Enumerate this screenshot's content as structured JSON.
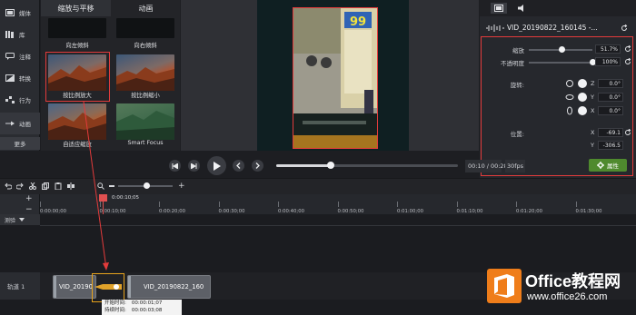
{
  "sidebar": {
    "items": [
      {
        "label": "媒体",
        "icon": "media-icon"
      },
      {
        "label": "库",
        "icon": "library-icon"
      },
      {
        "label": "注释",
        "icon": "annotation-icon"
      },
      {
        "label": "转换",
        "icon": "transition-icon"
      },
      {
        "label": "行为",
        "icon": "behavior-icon"
      },
      {
        "label": "动画",
        "icon": "animation-icon"
      }
    ],
    "more_label": "更多"
  },
  "media_panel": {
    "tabs": [
      "缩放与平移",
      "动画"
    ],
    "items": [
      {
        "label": "向左倾斜"
      },
      {
        "label": "向右倾斜"
      },
      {
        "label": "按比例放大"
      },
      {
        "label": "按比例缩小"
      },
      {
        "label": "自适应缩放"
      },
      {
        "label": "Smart Focus"
      }
    ]
  },
  "preview": {
    "sign_text": "99"
  },
  "properties": {
    "title": "VID_20190822_160145 -...",
    "scale_label": "缩放",
    "scale_value": "51.7%",
    "scale_fraction": 0.52,
    "opacity_label": "不透明度",
    "opacity_value": "100%",
    "opacity_fraction": 1.0,
    "rotation_label": "旋转:",
    "rot_z_label": "Z",
    "rot_z_value": "0.0°",
    "rot_y_label": "Y",
    "rot_y_value": "0.0°",
    "rot_x_label": "X",
    "rot_x_value": "0.0°",
    "position_label": "位置:",
    "pos_x_label": "X",
    "pos_x_value": "-69.1",
    "pos_y_label": "Y",
    "pos_y_value": "-306.5",
    "attr_button": "属性"
  },
  "playback": {
    "time_current": "00:10",
    "time_total": "00:28",
    "time_sep": "/",
    "fps": "30fps",
    "progress_fraction": 0.3
  },
  "timeline": {
    "playhead_time": "0:00:10;05",
    "ticks": [
      "0:00:00;00",
      "0:00:10;00",
      "0:00:20;00",
      "0:00:30;00",
      "0:00:40;00",
      "0:00:50;00",
      "0:01:00;00",
      "0:01:10;00",
      "0:01:20;00",
      "0:01:30;00"
    ],
    "marker_label": "测验",
    "track_label": "轨道 1",
    "clip1_label": "VID_20190",
    "clip2_label": "VID_20190822_160",
    "tooltip_start": "开始时间:",
    "tooltip_start_value": "00:00:01;07",
    "tooltip_dur": "持续时间:",
    "tooltip_dur_value": "00:00:03;08"
  },
  "watermark": {
    "title": "Office教程网",
    "url": "www.office26.com"
  },
  "colors": {
    "highlight_red": "#e33b3b",
    "transition_orange": "#e6a21c",
    "attr_green": "#4f8a2e",
    "brand_orange": "#ef7d1a"
  }
}
